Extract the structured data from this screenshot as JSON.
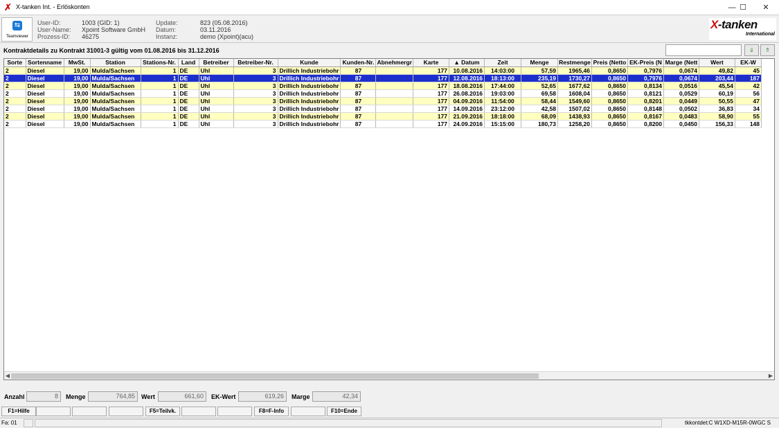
{
  "window": {
    "title": "X-tanken Int. - Erlöskonten",
    "minimize": "—",
    "maximize": "☐",
    "close": "✕"
  },
  "teamviewer": {
    "label": "Teamviewer",
    "icon": "teamviewer-icon"
  },
  "header": {
    "user_id_label": "User-ID:",
    "user_id": "1003 (GID: 1)",
    "user_name_label": "User-Name:",
    "user_name": "Xpoint Software GmbH",
    "process_id_label": "Prozess-ID:",
    "process_id": "46275",
    "update_label": "Update:",
    "update": "823 (05.08.2016)",
    "datum_label": "Datum:",
    "datum": "03.11.2016",
    "instanz_label": "Instanz:",
    "instanz": "demo (Xpoint)(acu)"
  },
  "logo": {
    "main_x": "X",
    "main_rest": "-tanken",
    "sub": "International"
  },
  "contract_title": "Kontraktdetails zu Kontrakt 31001-3 gültig vom 01.08.2016 bis 31.12.2016",
  "search": {
    "value": ""
  },
  "search_buttons": [
    "⇓",
    "⇑"
  ],
  "table": {
    "columns": [
      "Sorte",
      "Sortenname",
      "MwSt.",
      "Station",
      "Stations-Nr.",
      "Land",
      "Betreiber",
      "Betreiber-Nr.",
      "Kunde",
      "Kunden-Nr.",
      "Abnehmergr",
      "Karte",
      "▲ Datum",
      "Zeit",
      "Menge",
      "Restmenge",
      "Preis (Netto",
      "EK-Preis (N",
      "Marge (Nett",
      "Wert",
      "EK-W"
    ],
    "rows": [
      [
        "2",
        "Diesel",
        "19,00",
        "Mulda/Sachsen",
        "1",
        "DE",
        "Uhl",
        "3",
        "Drillich Industriebohr",
        "87",
        "",
        "177",
        "10.08.2016",
        "14:03:00",
        "57,59",
        "1965,46",
        "0,8650",
        "0,7976",
        "0,0674",
        "49,82",
        "45"
      ],
      [
        "2",
        "Diesel",
        "19,00",
        "Mulda/Sachsen",
        "1",
        "DE",
        "Uhl",
        "3",
        "Drillich Industriebohr",
        "87",
        "",
        "177",
        "12.08.2016",
        "18:13:00",
        "235,19",
        "1730,27",
        "0,8650",
        "0,7976",
        "0,0674",
        "203,44",
        "187"
      ],
      [
        "2",
        "Diesel",
        "19,00",
        "Mulda/Sachsen",
        "1",
        "DE",
        "Uhl",
        "3",
        "Drillich Industriebohr",
        "87",
        "",
        "177",
        "18.08.2016",
        "17:44:00",
        "52,65",
        "1677,62",
        "0,8650",
        "0,8134",
        "0,0516",
        "45,54",
        "42"
      ],
      [
        "2",
        "Diesel",
        "19,00",
        "Mulda/Sachsen",
        "1",
        "DE",
        "Uhl",
        "3",
        "Drillich Industriebohr",
        "87",
        "",
        "177",
        "26.08.2016",
        "19:03:00",
        "69,58",
        "1608,04",
        "0,8650",
        "0,8121",
        "0,0529",
        "60,19",
        "56"
      ],
      [
        "2",
        "Diesel",
        "19,00",
        "Mulda/Sachsen",
        "1",
        "DE",
        "Uhl",
        "3",
        "Drillich Industriebohr",
        "87",
        "",
        "177",
        "04.09.2016",
        "11:54:00",
        "58,44",
        "1549,60",
        "0,8650",
        "0,8201",
        "0,0449",
        "50,55",
        "47"
      ],
      [
        "2",
        "Diesel",
        "19,00",
        "Mulda/Sachsen",
        "1",
        "DE",
        "Uhl",
        "3",
        "Drillich Industriebohr",
        "87",
        "",
        "177",
        "14.09.2016",
        "23:12:00",
        "42,58",
        "1507,02",
        "0,8650",
        "0,8148",
        "0,0502",
        "36,83",
        "34"
      ],
      [
        "2",
        "Diesel",
        "19,00",
        "Mulda/Sachsen",
        "1",
        "DE",
        "Uhl",
        "3",
        "Drillich Industriebohr",
        "87",
        "",
        "177",
        "21.09.2016",
        "18:18:00",
        "68,09",
        "1438,93",
        "0,8650",
        "0,8167",
        "0,0483",
        "58,90",
        "55"
      ],
      [
        "2",
        "Diesel",
        "19,00",
        "Mulda/Sachsen",
        "1",
        "DE",
        "Uhl",
        "3",
        "Drillich Industriebohr",
        "87",
        "",
        "177",
        "24.09.2016",
        "15:15:00",
        "180,73",
        "1258,20",
        "0,8650",
        "0,8200",
        "0,0450",
        "156,33",
        "148"
      ]
    ],
    "row_styles": [
      "yel",
      "sel",
      "yel",
      "wht",
      "yel",
      "wht",
      "yel",
      "wht"
    ]
  },
  "summary": {
    "anzahl_label": "Anzahl",
    "anzahl": "8",
    "menge_label": "Menge",
    "menge": "764,85",
    "wert_label": "Wert",
    "wert": "661,60",
    "ek_wert_label": "EK-Wert",
    "ek_wert": "619,26",
    "marge_label": "Marge",
    "marge": "42,34"
  },
  "fkeys": [
    "F1=Hilfe",
    "",
    "",
    "",
    "F5=Teilvk.",
    "",
    "",
    "F8=F-Info",
    "",
    "F10=Ende"
  ],
  "status": {
    "left": "Fa: 01",
    "right": "tkkontdet:C W1XD-M15R-0WGC S"
  },
  "colors": {
    "selected_row": "#1c2fcc",
    "highlight_row": "#ffffc0",
    "brand_red": "#d01010"
  }
}
